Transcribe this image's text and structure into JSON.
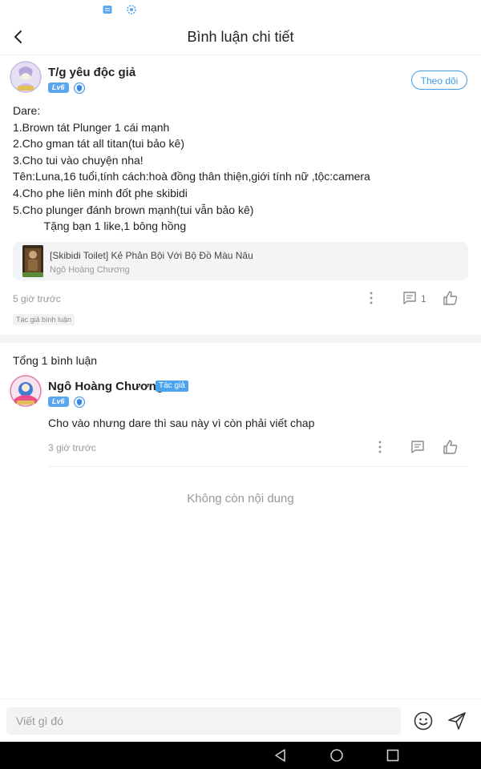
{
  "header": {
    "title": "Bình luận chi tiết"
  },
  "post": {
    "author": "T/g yêu độc giả",
    "level": "Lv6",
    "follow_label": "Theo dõi",
    "lines": [
      "Dare:",
      "1.Brown tát Plunger 1 cái mạnh",
      "2.Cho gman tát all titan(tui bảo kê)",
      "3.Cho tui vào chuyện nha!",
      "Tên:Luna,16 tuổi,tính cách:hoà đồng thân thiện,giới tính nữ ,tộc:camera",
      "4.Cho phe liên minh đốt phe skibidi",
      "5.Cho plunger đánh brown mạnh(tui vẫn bảo kê)",
      "          Tặng bạn 1 like,1 bông hồng"
    ],
    "story": {
      "title": "[Skibidi Toilet] Kẻ Phản Bội Với Bộ Đồ Màu Nâu",
      "author": "Ngô Hoàng Chương"
    },
    "time": "5 giờ trước",
    "reply_count": "1",
    "author_tag": "Tác giả bình luận"
  },
  "comments_section": {
    "total": "Tổng 1 bình luận",
    "comments": [
      {
        "author": "Ngô Hoàng Chương",
        "role": "Tác giả",
        "level": "Lv6",
        "text": "Cho vào nhưng dare thì sau này vì còn phải viết chap",
        "time": "3 giờ trước"
      }
    ],
    "end_text": "Không còn nội dung"
  },
  "input": {
    "placeholder": "Viết gì đó"
  },
  "colors": {
    "accent": "#3d9be9",
    "badge": "#5aa6ef"
  },
  "icons": [
    "back-icon",
    "more-icon",
    "comment-icon",
    "like-icon",
    "emoji-icon",
    "send-icon",
    "nav-back-icon",
    "nav-home-icon",
    "nav-recents-icon"
  ]
}
